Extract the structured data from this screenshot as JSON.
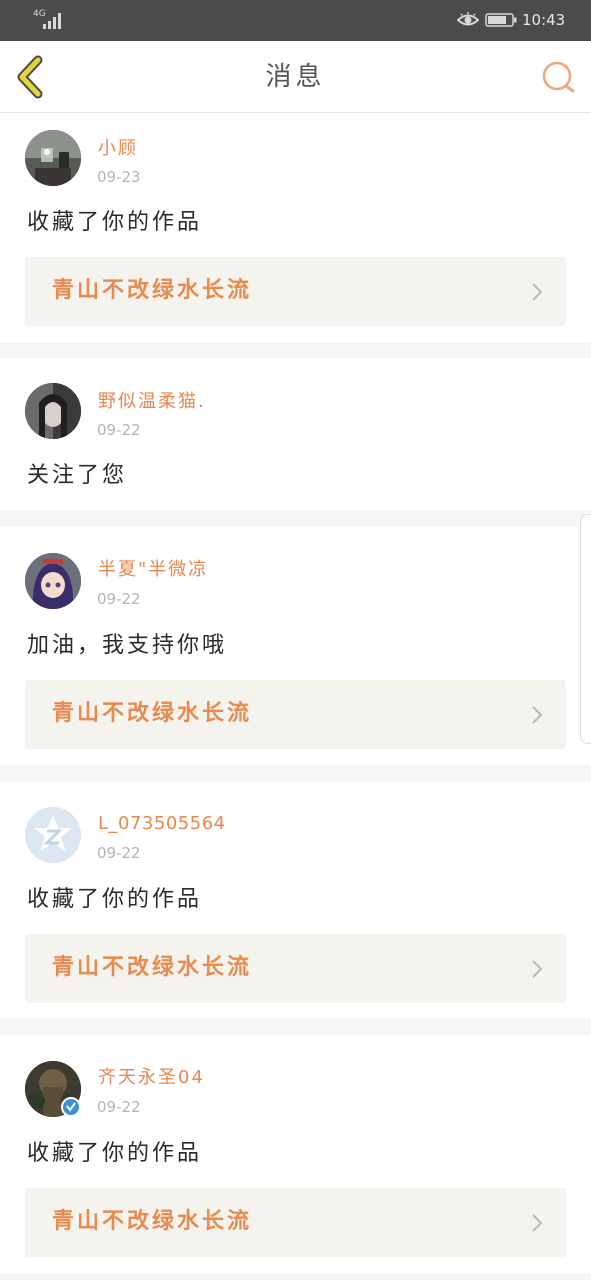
{
  "status_bar": {
    "network": "4G",
    "time": "10:43"
  },
  "header": {
    "title": "消息"
  },
  "messages": [
    {
      "username": "小顾",
      "date": "09-23",
      "text": "收藏了你的作品",
      "work_title": "青山不改绿水长流",
      "avatar_icon": "avatar-photo-icon"
    },
    {
      "username": "野似温柔猫.",
      "date": "09-22",
      "text": "关注了您",
      "avatar_icon": "avatar-photo-icon"
    },
    {
      "username": "半夏\"半微凉",
      "date": "09-22",
      "text": "加油，我支持你哦",
      "work_title": "青山不改绿水长流",
      "avatar_icon": "avatar-anime-icon"
    },
    {
      "username": "L_073505564",
      "date": "09-22",
      "text": "收藏了你的作品",
      "work_title": "青山不改绿水长流",
      "avatar_icon": "default-avatar-icon"
    },
    {
      "username": "齐天永圣04",
      "date": "09-22",
      "text": "收藏了你的作品",
      "work_title": "青山不改绿水长流",
      "avatar_icon": "avatar-photo-icon",
      "verified_icon": "verified-badge-icon"
    }
  ],
  "colors": {
    "accent": "#e9874e",
    "back_arrow": "#e3d53a",
    "card_bg": "#f4f3ee",
    "separator": "#f7f5f5",
    "status_bar": "#4b4b4b",
    "verified": "#3a8fd6"
  }
}
